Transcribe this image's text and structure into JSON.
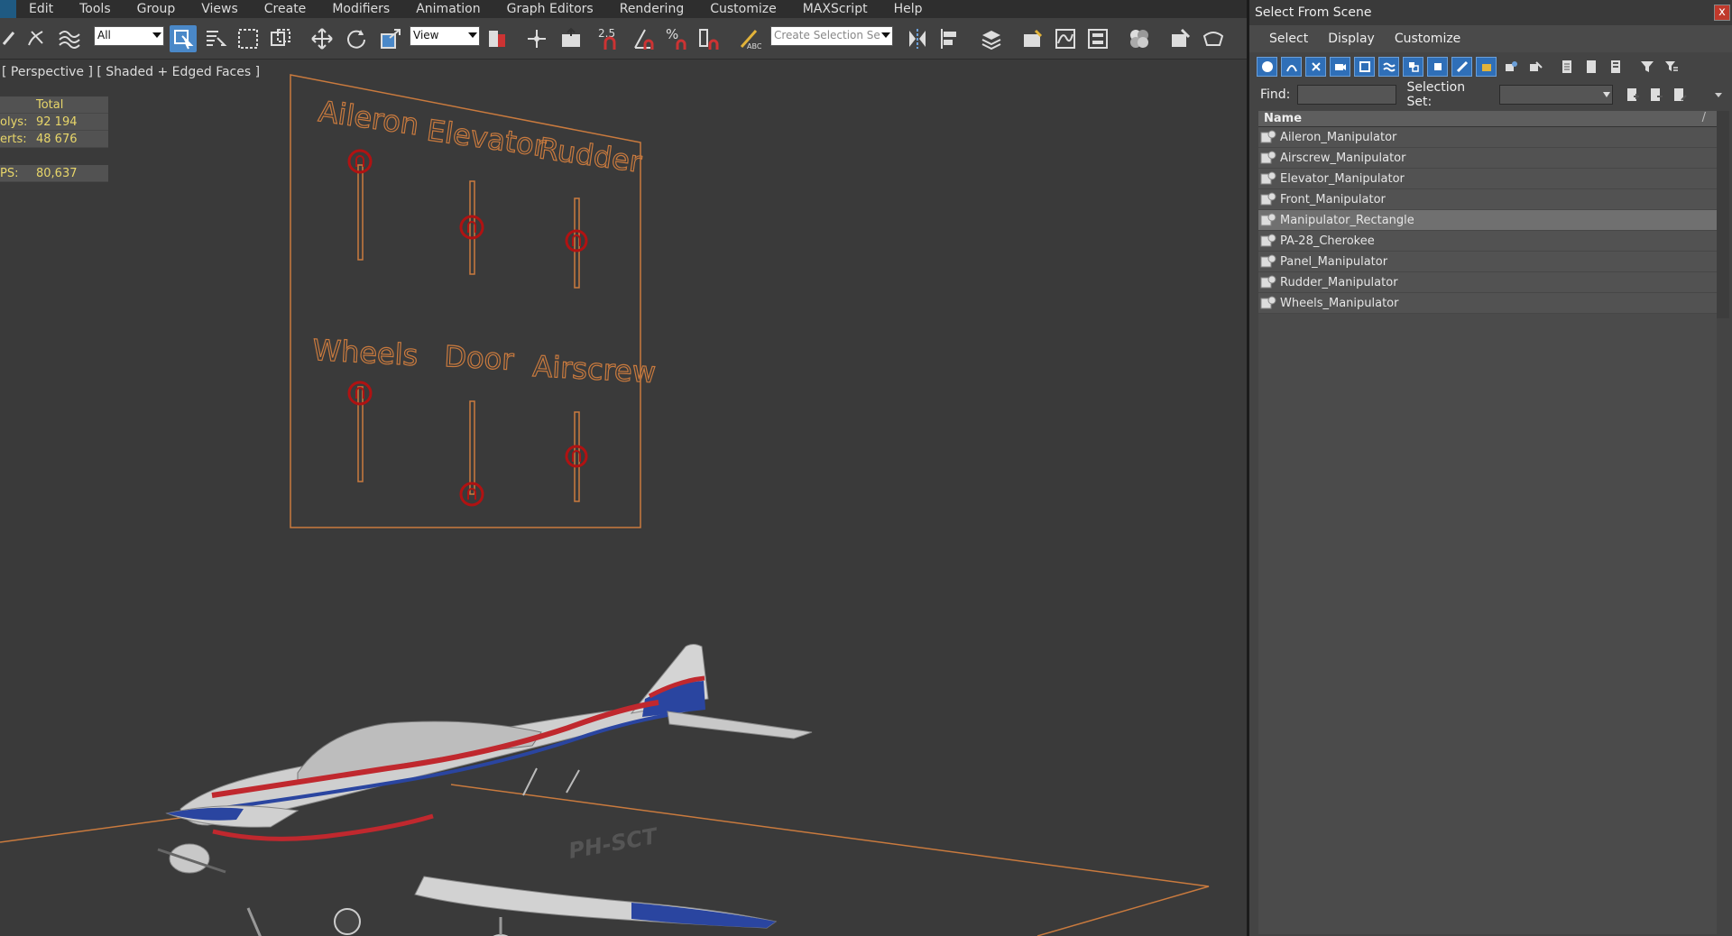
{
  "menubar": {
    "items": [
      "Edit",
      "Tools",
      "Group",
      "Views",
      "Create",
      "Modifiers",
      "Animation",
      "Graph Editors",
      "Rendering",
      "Customize",
      "MAXScript",
      "Help"
    ]
  },
  "toolbar": {
    "selection_filter": "All",
    "reference_coord": "View",
    "named_selection_placeholder": "Create Selection Se",
    "snap_label": "2.5"
  },
  "viewport": {
    "label": "[ Perspective ] [ Shaded + Edged Faces ]",
    "stats": {
      "header": "Total",
      "rows": [
        {
          "key": "olys:",
          "value": "92 194"
        },
        {
          "key": "erts:",
          "value": "48 676"
        },
        {
          "key": "PS:",
          "value": "80,637"
        }
      ]
    },
    "panel_labels": [
      "Aileron",
      "Elevator",
      "Rudder",
      "Wheels",
      "Door",
      "Airscrew"
    ],
    "registration": "PH-SCT"
  },
  "dialog": {
    "title": "Select From Scene",
    "close_label": "x",
    "menu": [
      "Select",
      "Display",
      "Customize"
    ],
    "find_label": "Find:",
    "selection_set_label": "Selection Set:",
    "column_header": "Name",
    "sort_indicator": "/",
    "items": [
      {
        "name": "Aileron_Manipulator",
        "selected": false
      },
      {
        "name": "Airscrew_Manipulator",
        "selected": false
      },
      {
        "name": "Elevator_Manipulator",
        "selected": false
      },
      {
        "name": "Front_Manipulator",
        "selected": false
      },
      {
        "name": "Manipulator_Rectangle",
        "selected": true
      },
      {
        "name": "PA-28_Cherokee",
        "selected": false
      },
      {
        "name": "Panel_Manipulator",
        "selected": false
      },
      {
        "name": "Rudder_Manipulator",
        "selected": false
      },
      {
        "name": "Wheels_Manipulator",
        "selected": false
      }
    ]
  },
  "colors": {
    "panel_wire": "#c97a3e",
    "manipulator_ring": "#b01212",
    "stats_text": "#e8d66a",
    "selection_highlight": "#707070",
    "toolbar_active": "#4a88c8"
  }
}
